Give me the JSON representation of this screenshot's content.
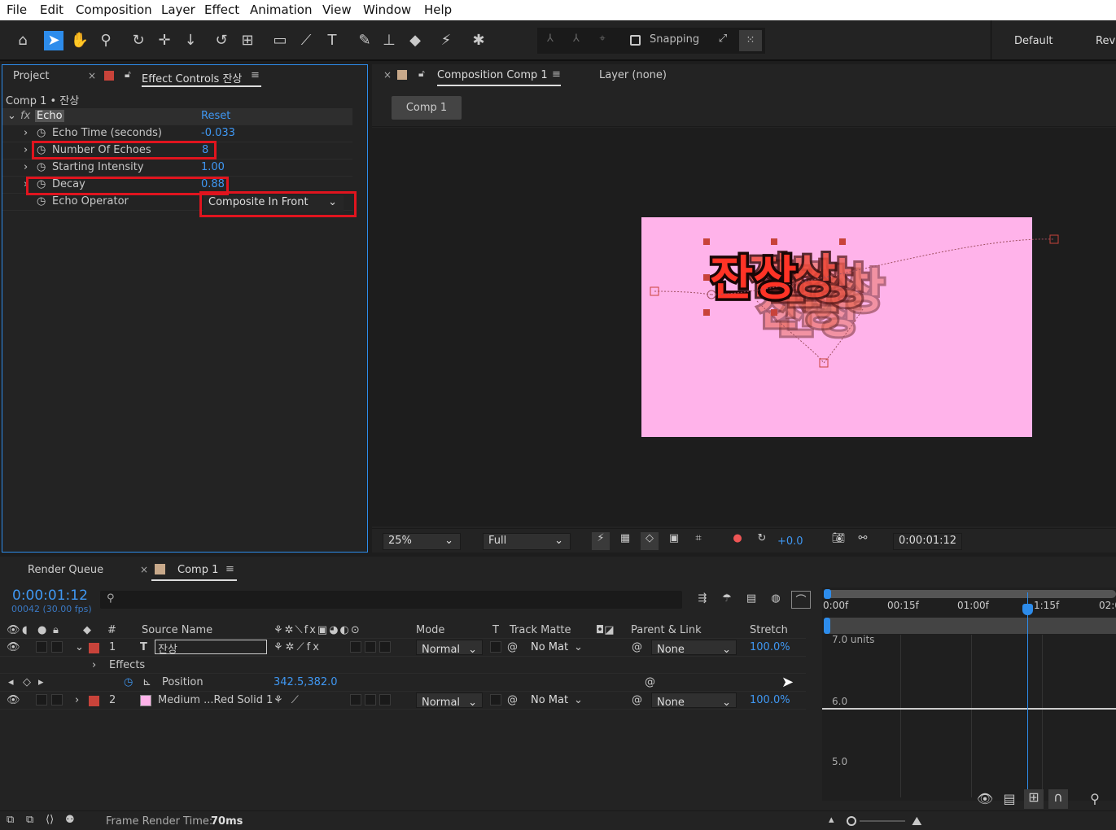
{
  "menu": [
    "File",
    "Edit",
    "Composition",
    "Layer",
    "Effect",
    "Animation",
    "View",
    "Window",
    "Help"
  ],
  "toolbar": {
    "snapping": "Snapping",
    "workspace": "Default",
    "review": "Rev"
  },
  "left_panel": {
    "tab_project": "Project",
    "tab_effect": "Effect Controls 잔상",
    "breadcrumb": "Comp 1 • 잔상",
    "effect_name": "Echo",
    "reset": "Reset",
    "props": [
      {
        "name": "Echo Time (seconds)",
        "value": "-0.033"
      },
      {
        "name": "Number Of Echoes",
        "value": "8"
      },
      {
        "name": "Starting Intensity",
        "value": "1.00"
      },
      {
        "name": "Decay",
        "value": "0.88"
      },
      {
        "name": "Echo Operator",
        "value": "Composite In Front"
      }
    ]
  },
  "viewer": {
    "tab_comp": "Composition Comp 1",
    "tab_layer": "Layer (none)",
    "comp_tab": "Comp 1",
    "text_content": "잔상",
    "zoom": "25%",
    "resolution": "Full",
    "exposure": "+0.0",
    "timecode": "0:00:01:12"
  },
  "timeline": {
    "tab_render": "Render Queue",
    "tab_comp": "Comp 1",
    "current_time": "0:00:01:12",
    "frame_info": "00042 (30.00 fps)",
    "search_placeholder": "",
    "headers": {
      "num": "#",
      "source": "Source Name",
      "mode": "Mode",
      "t": "T",
      "track": "Track Matte",
      "parent": "Parent & Link",
      "stretch": "Stretch"
    },
    "layers": [
      {
        "num": "1",
        "name": "잔상",
        "mode": "Normal",
        "matte": "No Mat",
        "parent": "None",
        "stretch": "100.0%"
      },
      {
        "num": "2",
        "name": "Medium ...Red Solid 1",
        "mode": "Normal",
        "matte": "No Mat",
        "parent": "None",
        "stretch": "100.0%"
      }
    ],
    "effects_label": "Effects",
    "position_label": "Position",
    "position_value": "342.5,382.0",
    "ruler": [
      "0:00f",
      "00:15f",
      "01:00f",
      "1:15f",
      "02:0"
    ],
    "graph_labels": [
      "7.0 units",
      "6.0",
      "5.0"
    ],
    "frame_render_label": "Frame Render Time:",
    "frame_render_value": "70ms"
  }
}
